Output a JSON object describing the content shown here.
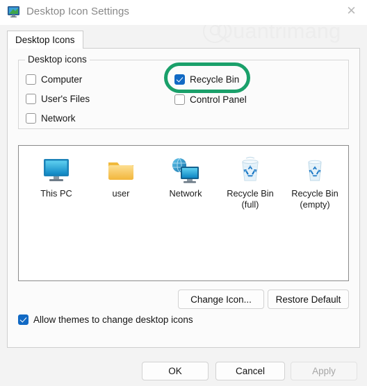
{
  "window": {
    "title": "Desktop Icon Settings",
    "app_icon": "desktop-monitor-icon",
    "close_glyph": "✕"
  },
  "watermark": {
    "text": "Quantrimang"
  },
  "tabs": [
    {
      "label": "Desktop Icons",
      "selected": true
    }
  ],
  "group": {
    "legend": "Desktop icons",
    "checkboxes": [
      {
        "label": "Computer",
        "checked": false
      },
      {
        "label": "User's Files",
        "checked": false
      },
      {
        "label": "Network",
        "checked": false
      },
      {
        "label": "Recycle Bin",
        "checked": true,
        "highlighted": true
      },
      {
        "label": "Control Panel",
        "checked": false
      }
    ]
  },
  "preview": {
    "icons": [
      {
        "caption": "This PC",
        "icon": "monitor-icon"
      },
      {
        "caption": "user",
        "icon": "folder-icon"
      },
      {
        "caption": "Network",
        "icon": "network-globe-monitor-icon"
      },
      {
        "caption": "Recycle Bin (full)",
        "caption_line1": "Recycle Bin",
        "caption_line2": "(full)",
        "icon": "recycle-bin-full-icon"
      },
      {
        "caption": "Recycle Bin (empty)",
        "caption_line1": "Recycle Bin",
        "caption_line2": "(empty)",
        "icon": "recycle-bin-empty-icon"
      }
    ]
  },
  "actions": {
    "change_icon": "Change Icon...",
    "restore_default": "Restore Default"
  },
  "allow_themes": {
    "label": "Allow themes to change desktop icons",
    "checked": true
  },
  "footer": {
    "ok": "OK",
    "cancel": "Cancel",
    "apply": "Apply",
    "apply_disabled": true
  },
  "colors": {
    "checkbox_accent": "#1169c4",
    "highlight_green": "#1aa06a",
    "title_text": "#888888"
  }
}
